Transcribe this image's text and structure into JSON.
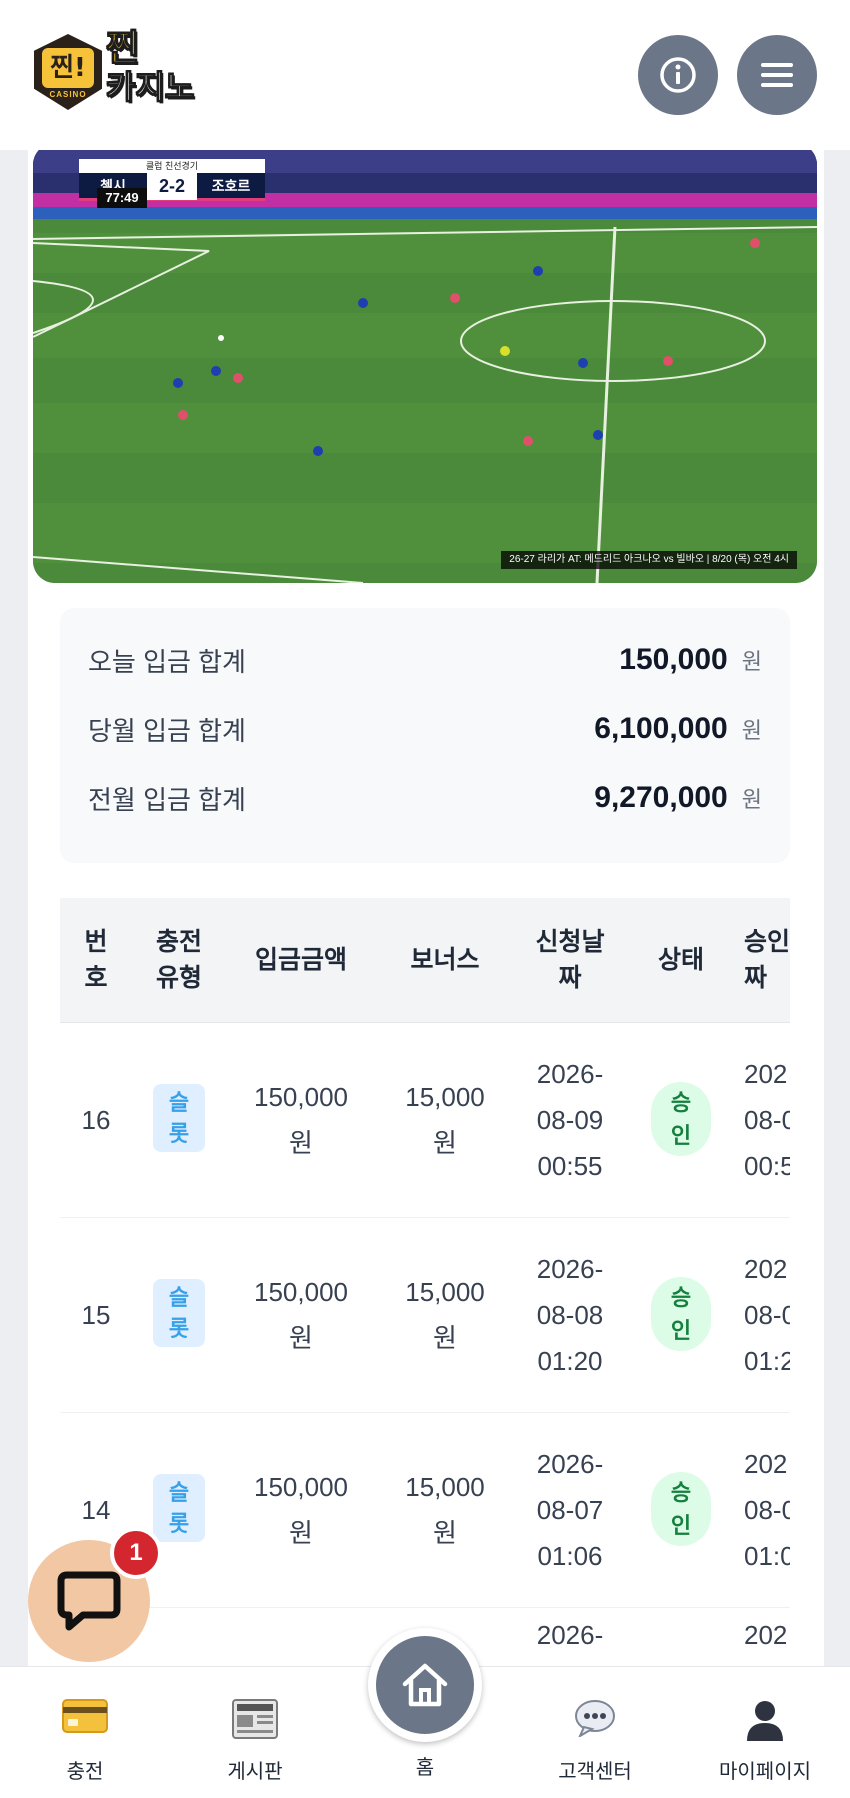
{
  "header": {
    "logo_badge": "찐!",
    "logo_badge_sub": "CASINO",
    "logo_line1": "찐",
    "logo_line2": "카지노",
    "info_icon": "info-icon",
    "menu_icon": "hamburger-menu-icon"
  },
  "video": {
    "scorebug_title": "클럽 친선경기",
    "home_team": "첼시",
    "score": "2-2",
    "away_team": "조호르",
    "clock": "77:49",
    "ticker": "26-27 라리가 AT: 메드리드 아크나오 vs 빌바오 | 8/20 (목) 오전 4시"
  },
  "summary": {
    "rows": [
      {
        "label": "오늘 입금 합계",
        "value": "150,000",
        "unit": "원"
      },
      {
        "label": "당월 입금 합계",
        "value": "6,100,000",
        "unit": "원"
      },
      {
        "label": "전월 입금 합계",
        "value": "9,270,000",
        "unit": "원"
      }
    ]
  },
  "table": {
    "headers": [
      "번\n호",
      "충전\n유형",
      "입금금액",
      "보너스",
      "신청날\n짜",
      "상태",
      "승인\n짜"
    ],
    "rows": [
      {
        "no": "16",
        "type": "슬\n롯",
        "amount": "150,000\n원",
        "bonus": "15,000\n원",
        "date": "2026-\n08-09\n00:55",
        "status": "승\n인",
        "approved": "202\n08-0\n00:5"
      },
      {
        "no": "15",
        "type": "슬\n롯",
        "amount": "150,000\n원",
        "bonus": "15,000\n원",
        "date": "2026-\n08-08\n01:20",
        "status": "승\n인",
        "approved": "202\n08-0\n01:2"
      },
      {
        "no": "14",
        "type": "슬\n롯",
        "amount": "150,000\n원",
        "bonus": "15,000\n원",
        "date": "2026-\n08-07\n01:06",
        "status": "승\n인",
        "approved": "202\n08-0\n01:0"
      },
      {
        "no": "",
        "type": "",
        "amount": "",
        "bonus": "",
        "date": "2026-",
        "status": "",
        "approved": "202"
      }
    ]
  },
  "chat": {
    "badge_count": "1",
    "icon": "chat-bubble-icon"
  },
  "bottom_nav": {
    "items": [
      {
        "label": "충전",
        "icon": "credit-card-icon"
      },
      {
        "label": "게시판",
        "icon": "newspaper-icon"
      },
      {
        "label": "홈",
        "icon": "home-icon"
      },
      {
        "label": "고객센터",
        "icon": "speech-bubble-icon"
      },
      {
        "label": "마이페이지",
        "icon": "person-icon"
      }
    ]
  },
  "colors": {
    "header_button": "#6b7689",
    "status_bg": "#dcfce7",
    "status_text": "#15803d",
    "tag_bg": "#e0efff",
    "tag_text": "#38a0e8",
    "chat_bg": "#f2c7a4",
    "badge_red": "#d3262f"
  }
}
